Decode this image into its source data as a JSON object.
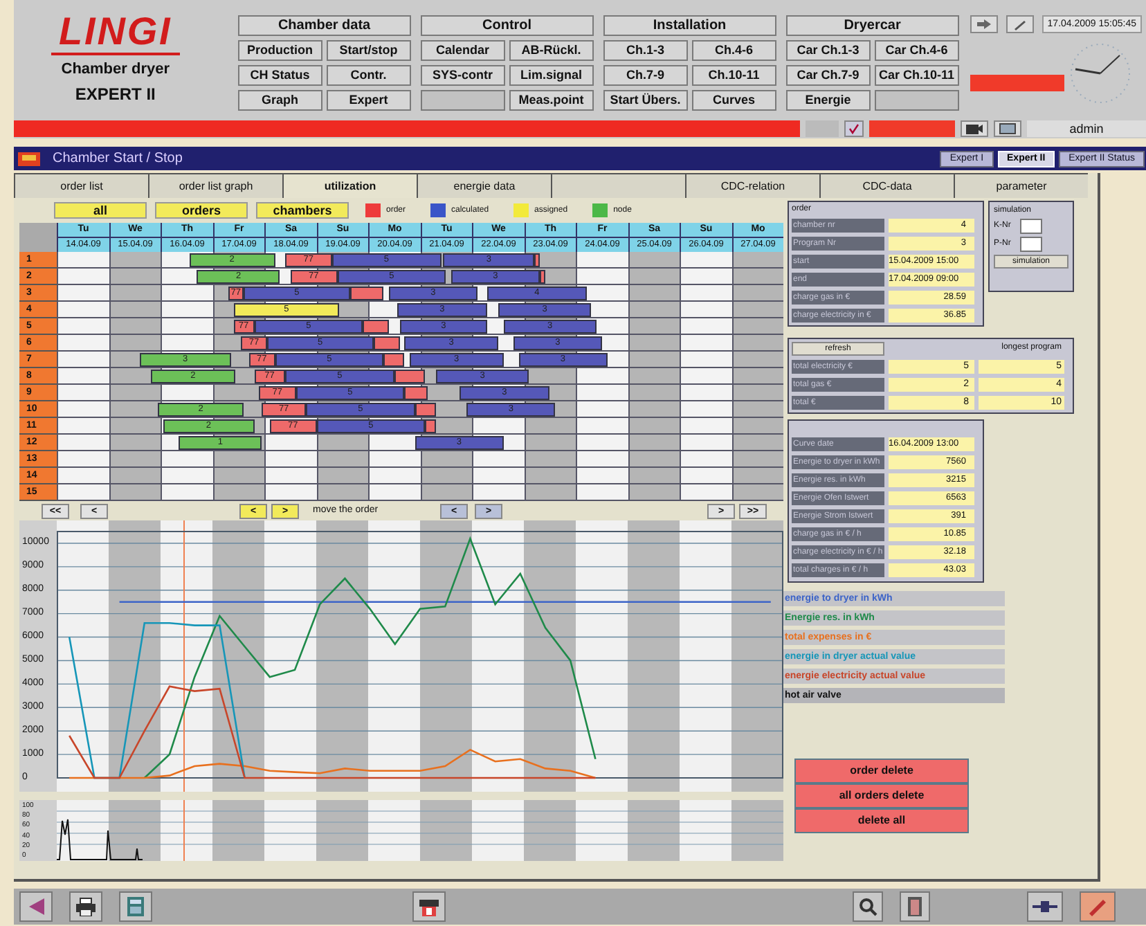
{
  "header": {
    "logo": "LINGI",
    "product": "Chamber dryer",
    "edition": "EXPERT II",
    "menu_groups": [
      {
        "title": "Chamber data",
        "buttons": [
          {
            "label": "Production"
          },
          {
            "label": "Start/stop"
          },
          {
            "label": "CH Status"
          },
          {
            "label": "Contr."
          },
          {
            "label": "Graph"
          },
          {
            "label": "Expert"
          }
        ]
      },
      {
        "title": "Control",
        "buttons": [
          {
            "label": "Calendar"
          },
          {
            "label": "AB-Rückl."
          },
          {
            "label": "SYS-contr"
          },
          {
            "label": "Lim.signal"
          },
          {
            "kind": "blank"
          },
          {
            "label": "Meas.point"
          }
        ]
      },
      {
        "title": "Installation",
        "buttons": [
          {
            "label": "Ch.1-3"
          },
          {
            "label": "Ch.4-6"
          },
          {
            "label": "Ch.7-9"
          },
          {
            "label": "Ch.10-11"
          },
          {
            "label": "Start Übers."
          },
          {
            "label": "Curves"
          }
        ]
      },
      {
        "title": "Dryercar",
        "buttons": [
          {
            "label": "Car Ch.1-3"
          },
          {
            "label": "Car Ch.4-6"
          },
          {
            "label": "Car Ch.7-9"
          },
          {
            "label": "Car Ch.10-11"
          },
          {
            "label": "Energie"
          },
          {
            "kind": "blank"
          }
        ]
      }
    ],
    "datetime": "17.04.2009 15:05:45",
    "user": "admin"
  },
  "window": {
    "title": "Chamber Start / Stop",
    "modes": [
      {
        "label": "Expert I",
        "selected": false
      },
      {
        "label": "Expert II",
        "selected": true
      },
      {
        "label": "Expert II Status",
        "selected": false
      }
    ]
  },
  "tabs": [
    {
      "label": "order list",
      "selected": false
    },
    {
      "label": "order list graph",
      "selected": false
    },
    {
      "label": "utilization",
      "selected": true
    },
    {
      "label": "energie data",
      "selected": false
    },
    {
      "selected": false
    },
    {
      "label": "CDC-relation",
      "selected": false
    },
    {
      "label": "CDC-data",
      "selected": false
    },
    {
      "label": "parameter",
      "selected": false
    }
  ],
  "filters": [
    "all",
    "orders",
    "chambers"
  ],
  "legend": [
    {
      "label": "order",
      "color": "#ee3b3b"
    },
    {
      "label": "calculated",
      "color": "#3a55c8"
    },
    {
      "label": "assigned",
      "color": "#f2ea3a"
    },
    {
      "label": "node",
      "color": "#4cb848"
    }
  ],
  "gantt": {
    "days": [
      {
        "day": "Tu",
        "date": "14.04.09"
      },
      {
        "day": "We",
        "date": "15.04.09"
      },
      {
        "day": "Th",
        "date": "16.04.09"
      },
      {
        "day": "Fr",
        "date": "17.04.09"
      },
      {
        "day": "Sa",
        "date": "18.04.09"
      },
      {
        "day": "Su",
        "date": "19.04.09"
      },
      {
        "day": "Mo",
        "date": "20.04.09"
      },
      {
        "day": "Tu",
        "date": "21.04.09"
      },
      {
        "day": "We",
        "date": "22.04.09"
      },
      {
        "day": "Th",
        "date": "23.04.09"
      },
      {
        "day": "Fr",
        "date": "24.04.09"
      },
      {
        "day": "Sa",
        "date": "25.04.09"
      },
      {
        "day": "Su",
        "date": "26.04.09"
      },
      {
        "day": "Mo",
        "date": "27.04.09"
      }
    ],
    "rows": [
      {
        "label": "1",
        "bars": [
          {
            "kind": "node",
            "text": "2"
          },
          {
            "kind": "order",
            "text": "77"
          },
          {
            "kind": "calculated",
            "text": "5"
          },
          {
            "kind": "calculated",
            "text": "3"
          },
          {
            "kind": "order"
          }
        ]
      },
      {
        "label": "2",
        "bars": [
          {
            "kind": "node",
            "text": "2"
          },
          {
            "kind": "order",
            "text": "77"
          },
          {
            "kind": "calculated",
            "text": "5"
          },
          {
            "kind": "calculated",
            "text": "3"
          },
          {
            "kind": "order"
          }
        ]
      },
      {
        "label": "3",
        "bars": [
          {
            "kind": "order",
            "text": "77"
          },
          {
            "kind": "calculated",
            "text": "5"
          },
          {
            "kind": "order"
          },
          {
            "kind": "calculated",
            "text": "3"
          },
          {
            "kind": "calculated",
            "text": "4"
          }
        ]
      },
      {
        "label": "4",
        "bars": [
          {
            "kind": "assigned",
            "text": "5"
          },
          {
            "kind": "calculated",
            "text": "3"
          },
          {
            "kind": "calculated",
            "text": "3"
          }
        ]
      },
      {
        "label": "5",
        "bars": [
          {
            "kind": "order",
            "text": "77"
          },
          {
            "kind": "calculated",
            "text": "5"
          },
          {
            "kind": "order"
          },
          {
            "kind": "calculated",
            "text": "3"
          },
          {
            "kind": "calculated",
            "text": "3"
          }
        ]
      },
      {
        "label": "6",
        "bars": [
          {
            "kind": "order",
            "text": "77"
          },
          {
            "kind": "calculated",
            "text": "5"
          },
          {
            "kind": "order"
          },
          {
            "kind": "calculated",
            "text": "3"
          },
          {
            "kind": "calculated",
            "text": "3"
          }
        ]
      },
      {
        "label": "7",
        "bars": [
          {
            "kind": "node",
            "text": "3"
          },
          {
            "kind": "order",
            "text": "77"
          },
          {
            "kind": "calculated",
            "text": "5"
          },
          {
            "kind": "order"
          },
          {
            "kind": "calculated",
            "text": "3"
          },
          {
            "kind": "calculated",
            "text": "3"
          }
        ]
      },
      {
        "label": "8",
        "bars": [
          {
            "kind": "node",
            "text": "2"
          },
          {
            "kind": "order",
            "text": "77"
          },
          {
            "kind": "calculated",
            "text": "5"
          },
          {
            "kind": "order"
          },
          {
            "kind": "calculated",
            "text": "3"
          }
        ]
      },
      {
        "label": "9",
        "bars": [
          {
            "kind": "order",
            "text": "77"
          },
          {
            "kind": "calculated",
            "text": "5"
          },
          {
            "kind": "order"
          },
          {
            "kind": "calculated",
            "text": "3"
          }
        ]
      },
      {
        "label": "10",
        "bars": [
          {
            "kind": "node",
            "text": "2"
          },
          {
            "kind": "order",
            "text": "77"
          },
          {
            "kind": "calculated",
            "text": "5"
          },
          {
            "kind": "order"
          },
          {
            "kind": "calculated",
            "text": "3"
          }
        ]
      },
      {
        "label": "11",
        "bars": [
          {
            "kind": "node",
            "text": "2"
          },
          {
            "kind": "order",
            "text": "77"
          },
          {
            "kind": "calculated",
            "text": "5"
          },
          {
            "kind": "order"
          }
        ]
      },
      {
        "label": "12",
        "bars": [
          {
            "kind": "node",
            "text": "1"
          },
          {
            "kind": "calculated",
            "text": "3"
          }
        ]
      },
      {
        "label": "13",
        "bars": []
      },
      {
        "label": "14",
        "bars": []
      },
      {
        "label": "15",
        "bars": []
      }
    ],
    "nav": {
      "first": "<<",
      "prev": "<",
      "move_left": "<",
      "move_right": ">",
      "move_label": "move the order",
      "step_left": "<",
      "step_right": ">",
      "next": ">",
      "last": ">>"
    }
  },
  "energy_chart": {
    "chart_data": {
      "type": "line",
      "categories": [
        null,
        null,
        null,
        null,
        null,
        null,
        null,
        null,
        null,
        null,
        null,
        null,
        null,
        null,
        null,
        null,
        null,
        null,
        null,
        null,
        null,
        null,
        null,
        null,
        null,
        null,
        null,
        null,
        null
      ],
      "grid": true,
      "ylim": [
        0,
        10500
      ],
      "yticks": [
        0,
        1000,
        2000,
        3000,
        4000,
        5000,
        6000,
        7000,
        8000,
        9000,
        10000
      ],
      "series": [
        {
          "name": "energie to dryer in kWh",
          "color": "#3d64c8",
          "values": [
            null,
            null,
            7500,
            7500,
            7500,
            7500,
            7500,
            7500,
            7500,
            7500,
            7500,
            7500,
            7500,
            7500,
            7500,
            7500,
            7500,
            7500,
            7500,
            7500,
            7500,
            7500,
            7500,
            7500,
            7500,
            7500,
            7500,
            7500,
            7500
          ]
        },
        {
          "name": "Energie res. in kWh",
          "color": "#1f8a4a",
          "values": [
            null,
            null,
            null,
            0,
            1000,
            4300,
            6900,
            5600,
            4300,
            4600,
            7400,
            8500,
            7200,
            5700,
            7200,
            7300,
            10200,
            7400,
            8700,
            6400,
            5000,
            800,
            null,
            null,
            null,
            null,
            null,
            null,
            null
          ]
        },
        {
          "name": "total expenses in €",
          "color": "#e8701e",
          "values": [
            0,
            0,
            0,
            0,
            100,
            500,
            600,
            500,
            300,
            250,
            200,
            400,
            300,
            300,
            300,
            500,
            1200,
            700,
            800,
            400,
            300,
            0,
            null,
            null,
            null,
            null,
            null,
            null,
            null
          ]
        },
        {
          "name": "energie in dryer actual value",
          "color": "#1696b8",
          "values": [
            6000,
            0,
            0,
            6600,
            6600,
            6500,
            6500,
            0,
            null,
            null,
            null,
            null,
            null,
            null,
            null,
            null,
            null,
            null,
            null,
            null,
            null,
            null,
            null,
            null,
            null,
            null,
            null,
            null,
            null
          ]
        },
        {
          "name": "energie electricity actual value",
          "color": "#c8462a",
          "values": [
            1800,
            0,
            0,
            2000,
            3900,
            3700,
            3800,
            0,
            0,
            0,
            0,
            0,
            0,
            0,
            0,
            0,
            0,
            0,
            0,
            0,
            0,
            0,
            null,
            null,
            null,
            null,
            null,
            null,
            null
          ]
        }
      ]
    }
  },
  "valve_chart": {
    "label": "hot air valve",
    "yticks": [
      "100",
      "80",
      "60",
      "40",
      "20",
      "0"
    ]
  },
  "order": {
    "title": "order",
    "fields": [
      {
        "label": "chamber nr",
        "value": "4"
      },
      {
        "label": "Program Nr",
        "value": "3"
      },
      {
        "label": "start",
        "value": "15.04.2009 15:00"
      },
      {
        "label": "end",
        "value": "17.04.2009 09:00"
      },
      {
        "label": "charge gas in €",
        "value": "28.59"
      },
      {
        "label": "charge electricity in €",
        "value": "36.85"
      }
    ]
  },
  "simulation": {
    "title": "simulation",
    "fields": [
      {
        "label": "K-Nr"
      },
      {
        "label": "P-Nr"
      }
    ],
    "button": "simulation"
  },
  "totals": {
    "refresh": "refresh",
    "column": "longest program",
    "rows": [
      {
        "label": "total electricity €",
        "value": "5",
        "longest": "5"
      },
      {
        "label": "total gas €",
        "value": "2",
        "longest": "4"
      },
      {
        "label": "total €",
        "value": "8",
        "longest": "10"
      }
    ]
  },
  "curve": {
    "fields": [
      {
        "label": "Curve date",
        "value": "16.04.2009 13:00"
      },
      {
        "label": "Energie to dryer in kWh",
        "value": "7560"
      },
      {
        "label": "Energie res. in kWh",
        "value": "3215"
      },
      {
        "label": "Energie Ofen Istwert",
        "value": "6563"
      },
      {
        "label": "Energie Strom Istwert",
        "value": "391"
      },
      {
        "label": "charge gas in € / h",
        "value": "10.85"
      },
      {
        "label": "charge electricity in € / h",
        "value": "32.18"
      },
      {
        "label": "total charges in € / h",
        "value": "43.03"
      }
    ]
  },
  "actions": [
    "order delete",
    "all orders delete",
    "delete all"
  ]
}
